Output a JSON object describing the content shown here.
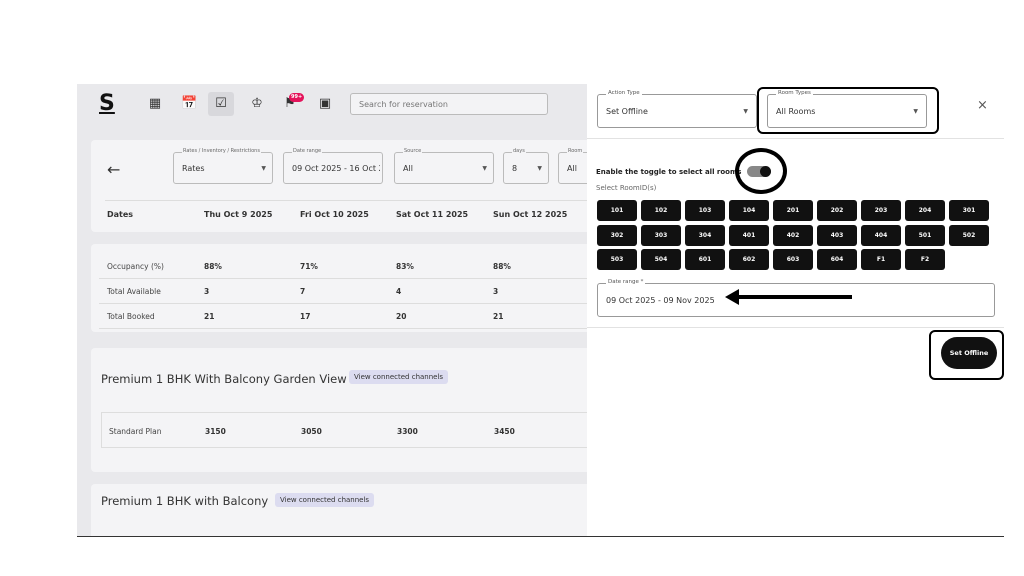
{
  "topbar": {
    "logo": "S",
    "notification_badge": "99+",
    "search_placeholder": "Search for reservation"
  },
  "filters": {
    "rates": {
      "label": "Rates / Inventory / Restrictions",
      "value": "Rates"
    },
    "date_range": {
      "label": "Date range",
      "value": "09 Oct 2025 - 16 Oct 2"
    },
    "source": {
      "label": "Source",
      "value": "All"
    },
    "days": {
      "label": "days",
      "value": "8"
    },
    "room": {
      "label": "Room",
      "value": "All"
    }
  },
  "date_header": [
    "Dates",
    "Thu Oct 9 2025",
    "Fri Oct 10 2025",
    "Sat Oct 11 2025",
    "Sun Oct 12 2025"
  ],
  "stats": [
    {
      "label": "Occupancy (%)",
      "values": [
        "88%",
        "71%",
        "83%",
        "88%"
      ]
    },
    {
      "label": "Total Available",
      "values": [
        "3",
        "7",
        "4",
        "3"
      ]
    },
    {
      "label": "Total Booked",
      "values": [
        "21",
        "17",
        "20",
        "21"
      ]
    }
  ],
  "rooms": [
    {
      "title": "Premium 1 BHK With Balcony Garden View",
      "chip": "View connected channels",
      "plan": {
        "label": "Standard Plan",
        "values": [
          "3150",
          "3050",
          "3300",
          "3450"
        ]
      }
    },
    {
      "title": "Premium 1 BHK with Balcony",
      "chip": "View connected channels"
    }
  ],
  "panel": {
    "action_type": {
      "label": "Action Type",
      "value": "Set Offline"
    },
    "room_types": {
      "label": "Room Types",
      "value": "All Rooms"
    },
    "close": "×",
    "toggle_label": "Enable the toggle to select all rooms",
    "select_label": "Select RoomID(s)",
    "room_ids": [
      "101",
      "102",
      "103",
      "104",
      "201",
      "202",
      "203",
      "204",
      "301",
      "302",
      "303",
      "304",
      "401",
      "402",
      "403",
      "404",
      "501",
      "502",
      "503",
      "504",
      "601",
      "602",
      "603",
      "604",
      "F1",
      "F2"
    ],
    "date_range": {
      "label": "Date range *",
      "value": "09 Oct 2025 - 09 Nov 2025"
    },
    "submit_label": "Set Offline"
  },
  "colors": {
    "badge": "#e4135b",
    "room_button": "#111111",
    "chip": "#dcdcf0"
  }
}
